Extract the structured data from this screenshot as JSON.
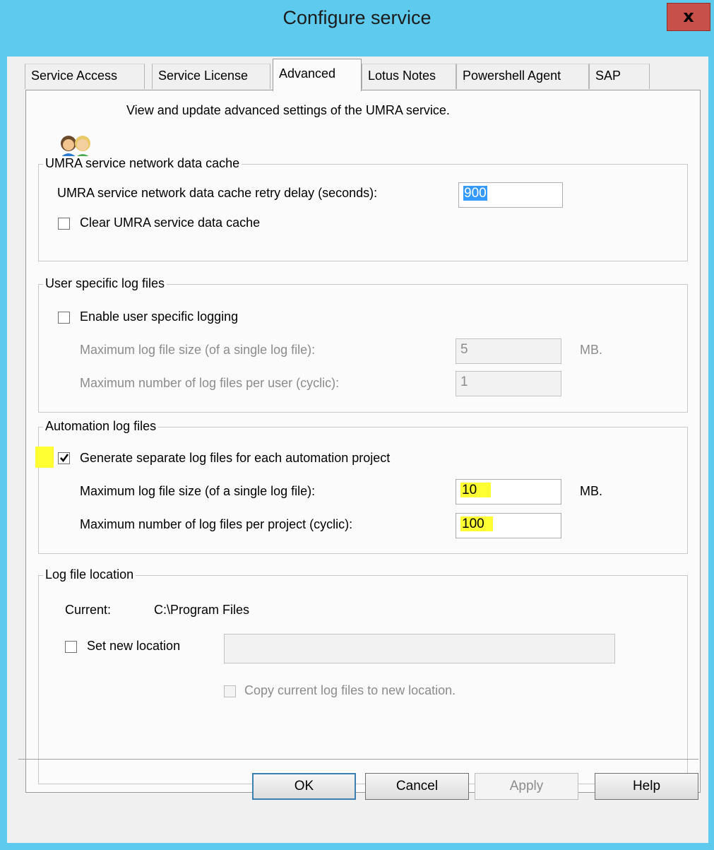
{
  "window": {
    "title": "Configure service",
    "close_label": "x"
  },
  "tabs": [
    {
      "label": "Service Access",
      "active": false
    },
    {
      "label": "Service License",
      "active": false
    },
    {
      "label": "Advanced",
      "active": true
    },
    {
      "label": "Lotus Notes",
      "active": false
    },
    {
      "label": "Powershell Agent",
      "active": false
    },
    {
      "label": "SAP",
      "active": false
    }
  ],
  "header": {
    "icon": "users-icon",
    "description": "View and update advanced settings of the UMRA service."
  },
  "cache_group": {
    "legend": "UMRA service network data cache",
    "retry_label": "UMRA service network data cache retry delay (seconds):",
    "retry_value": "900",
    "clear_label": "Clear UMRA service data cache",
    "clear_checked": false
  },
  "user_logs": {
    "legend": "User specific log files",
    "enable_label": "Enable user specific logging",
    "enable_checked": false,
    "max_size_label": "Maximum log file size (of a single log file):",
    "max_size_value": "5",
    "max_size_unit": "MB.",
    "max_count_label": "Maximum number of log files per user (cyclic):",
    "max_count_value": "1"
  },
  "automation_logs": {
    "legend": "Automation log files",
    "generate_label": "Generate separate log files for each automation project",
    "generate_checked": true,
    "max_size_label": "Maximum log file size (of a single log file):",
    "max_size_value": "10",
    "max_size_unit": "MB.",
    "max_count_label": "Maximum number of log files per project (cyclic):",
    "max_count_value": "100",
    "highlight_color": "#ffff33"
  },
  "location": {
    "legend": "Log file location",
    "current_label": "Current:",
    "current_value": "C:\\Program Files",
    "set_new_label": "Set new location",
    "set_new_checked": false,
    "new_path_value": "",
    "copy_label": "Copy current log files to new location.",
    "copy_checked": false
  },
  "buttons": {
    "ok": "OK",
    "cancel": "Cancel",
    "apply": "Apply",
    "help": "Help"
  },
  "colors": {
    "title_bar": "#5ecbee",
    "close_button": "#c7504a",
    "selection": "#3399ff"
  }
}
